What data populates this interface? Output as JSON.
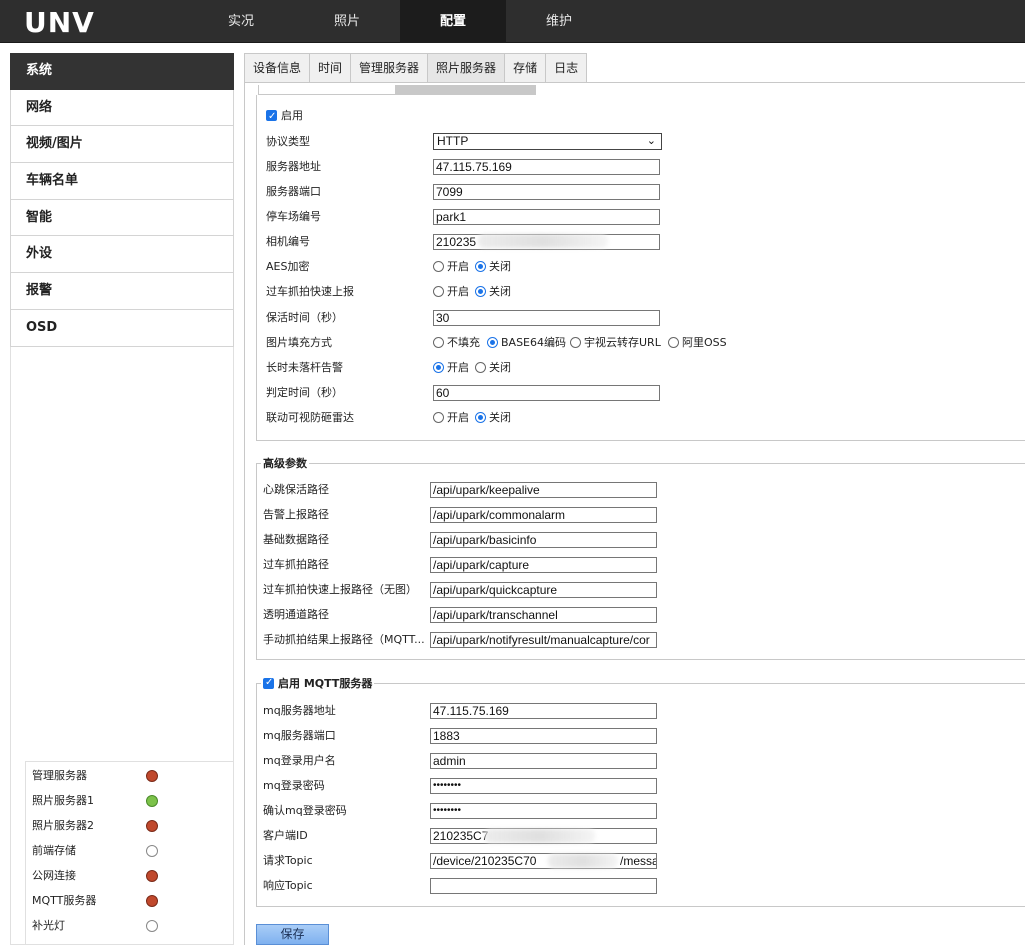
{
  "header": {
    "logo_text": "UNV",
    "nav": [
      "实况",
      "照片",
      "配置",
      "维护"
    ],
    "active_nav": "配置"
  },
  "sidebar": {
    "items": [
      "系统",
      "网络",
      "视频/图片",
      "车辆名单",
      "智能",
      "外设",
      "报警",
      "OSD"
    ],
    "active": "系统"
  },
  "status": {
    "items": [
      {
        "label": "管理服务器",
        "state": "red"
      },
      {
        "label": "照片服务器1",
        "state": "green"
      },
      {
        "label": "照片服务器2",
        "state": "red"
      },
      {
        "label": "前端存储",
        "state": "off"
      },
      {
        "label": "公网连接",
        "state": "red"
      },
      {
        "label": "MQTT服务器",
        "state": "red"
      },
      {
        "label": "补光灯",
        "state": "off"
      }
    ]
  },
  "tabs": [
    "设备信息",
    "时间",
    "管理服务器",
    "照片服务器",
    "存储",
    "日志"
  ],
  "active_tab": "照片服务器",
  "basic": {
    "enable_label": "启用",
    "protocol": {
      "label": "协议类型",
      "value": "HTTP"
    },
    "server_addr": {
      "label": "服务器地址",
      "value": "47.115.75.169"
    },
    "server_port": {
      "label": "服务器端口",
      "value": "7099"
    },
    "park_id": {
      "label": "停车场编号",
      "value": "park1"
    },
    "camera_id": {
      "label": "相机编号",
      "value": "210235"
    },
    "aes": {
      "label": "AES加密",
      "on": "开启",
      "off": "关闭"
    },
    "fast_report": {
      "label": "过车抓拍快速上报",
      "on": "开启",
      "off": "关闭"
    },
    "keepalive": {
      "label": "保活时间（秒）",
      "value": "30"
    },
    "fill_mode": {
      "label": "图片填充方式",
      "opts": [
        "不填充",
        "BASE64编码",
        "宇视云转存URL",
        "阿里OSS"
      ]
    },
    "long_alarm": {
      "label": "长时未落杆告警",
      "on": "开启",
      "off": "关闭"
    },
    "judge_time": {
      "label": "判定时间（秒）",
      "value": "60"
    },
    "radar": {
      "label": "联动可视防砸雷达",
      "on": "开启",
      "off": "关闭"
    }
  },
  "advanced": {
    "legend": "高级参数",
    "rows": [
      {
        "label": "心跳保活路径",
        "value": "/api/upark/keepalive"
      },
      {
        "label": "告警上报路径",
        "value": "/api/upark/commonalarm"
      },
      {
        "label": "基础数据路径",
        "value": "/api/upark/basicinfo"
      },
      {
        "label": "过车抓拍路径",
        "value": "/api/upark/capture"
      },
      {
        "label": "过车抓拍快速上报路径（无图）",
        "value": "/api/upark/quickcapture"
      },
      {
        "label": "透明通道路径",
        "value": "/api/upark/transchannel"
      },
      {
        "label": "手动抓拍结果上报路径（MQTT...",
        "value": "/api/upark/notifyresult/manualcapture/cor"
      }
    ]
  },
  "mqtt": {
    "legend": "启用 MQTT服务器",
    "rows": [
      {
        "label": "mq服务器地址",
        "value": "47.115.75.169"
      },
      {
        "label": "mq服务器端口",
        "value": "1883"
      },
      {
        "label": "mq登录用户名",
        "value": "admin"
      },
      {
        "label": "mq登录密码",
        "value": "••••••••"
      },
      {
        "label": "确认mq登录密码",
        "value": "••••••••"
      },
      {
        "label": "客户端ID",
        "value": "210235C7"
      },
      {
        "label": "请求Topic",
        "value": "/device/210235C70"
      },
      {
        "label": "响应Topic",
        "value": ""
      }
    ],
    "topic_tail": "/messa"
  },
  "save_label": "保存"
}
